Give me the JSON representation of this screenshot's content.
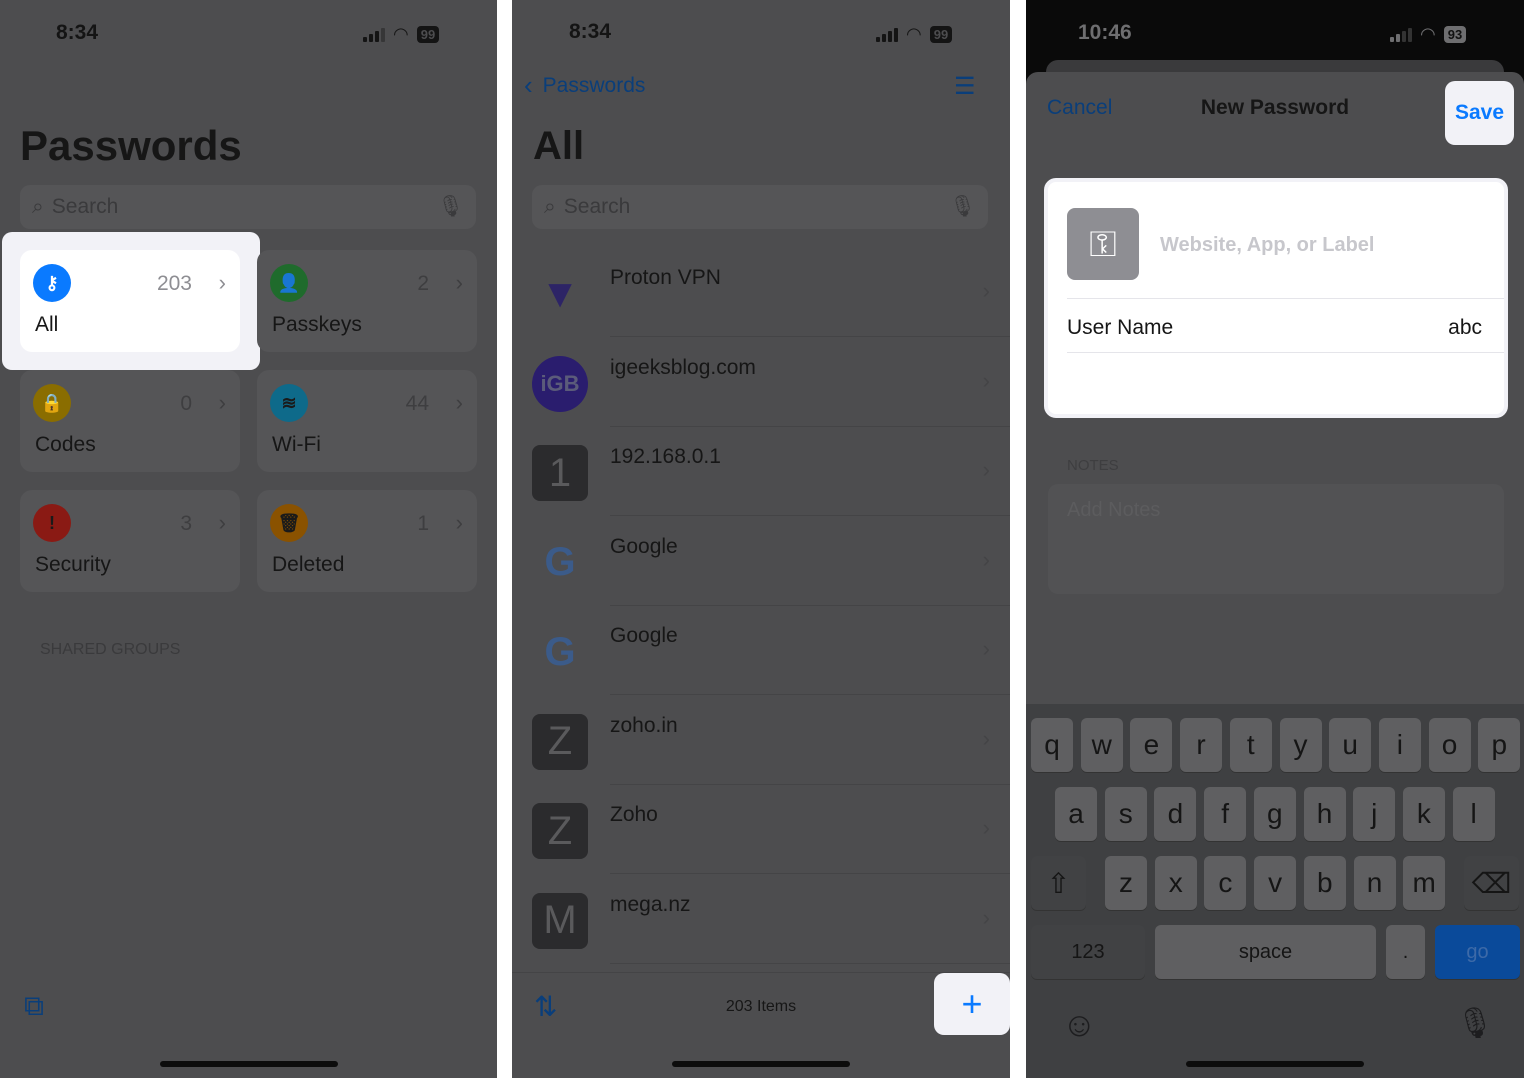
{
  "screen1": {
    "time": "8:34",
    "battery": "99",
    "title": "Passwords",
    "search_placeholder": "Search",
    "categories": [
      {
        "label": "All",
        "count": "203",
        "icon": "key-icon",
        "color": "#0a7aff"
      },
      {
        "label": "Passkeys",
        "count": "2",
        "icon": "person-key-icon",
        "color": "#1f6b2c"
      },
      {
        "label": "Codes",
        "count": "0",
        "icon": "lock-clock-icon",
        "color": "#8a6d00"
      },
      {
        "label": "Wi-Fi",
        "count": "44",
        "icon": "wifi-icon",
        "color": "#0e6a8a"
      },
      {
        "label": "Security",
        "count": "3",
        "icon": "exclamation-icon",
        "color": "#8a1a14"
      },
      {
        "label": "Deleted",
        "count": "1",
        "icon": "trash-icon",
        "color": "#8a5200"
      }
    ],
    "shared_groups": "SHARED GROUPS"
  },
  "screen2": {
    "time": "8:34",
    "battery": "99",
    "back_label": "Passwords",
    "title": "All",
    "search_placeholder": "Search",
    "items": [
      {
        "name": "Proton VPN",
        "icon": "proton-vpn-icon"
      },
      {
        "name": "igeeksblog.com",
        "icon": "igb-icon",
        "glyph": "iGB"
      },
      {
        "name": "192.168.0.1",
        "icon": "letter-tile-icon",
        "glyph": "1"
      },
      {
        "name": "Google",
        "icon": "google-icon",
        "glyph": "G"
      },
      {
        "name": "Google",
        "icon": "google-icon",
        "glyph": "G"
      },
      {
        "name": "zoho.in",
        "icon": "letter-tile-icon",
        "glyph": "Z"
      },
      {
        "name": "Zoho",
        "icon": "letter-tile-icon",
        "glyph": "Z"
      },
      {
        "name": "mega.nz",
        "icon": "letter-tile-icon",
        "glyph": "M"
      }
    ],
    "item_count": "203 Items"
  },
  "screen3": {
    "time": "10:46",
    "battery": "93",
    "cancel": "Cancel",
    "title": "New Password",
    "save": "Save",
    "website_placeholder": "Website, App, or Label",
    "username_label": "User Name",
    "username_value": "abc",
    "notes_header": "NOTES",
    "notes_placeholder": "Add Notes",
    "keyboard": {
      "row1": [
        "q",
        "w",
        "e",
        "r",
        "t",
        "y",
        "u",
        "i",
        "o",
        "p"
      ],
      "row2": [
        "a",
        "s",
        "d",
        "f",
        "g",
        "h",
        "j",
        "k",
        "l"
      ],
      "row3": [
        "z",
        "x",
        "c",
        "v",
        "b",
        "n",
        "m"
      ],
      "numbers": "123",
      "space": "space",
      "period": ".",
      "go": "go"
    }
  },
  "colors": {
    "accent": "#0a7aff",
    "dim_background": "#4d4d4f"
  }
}
